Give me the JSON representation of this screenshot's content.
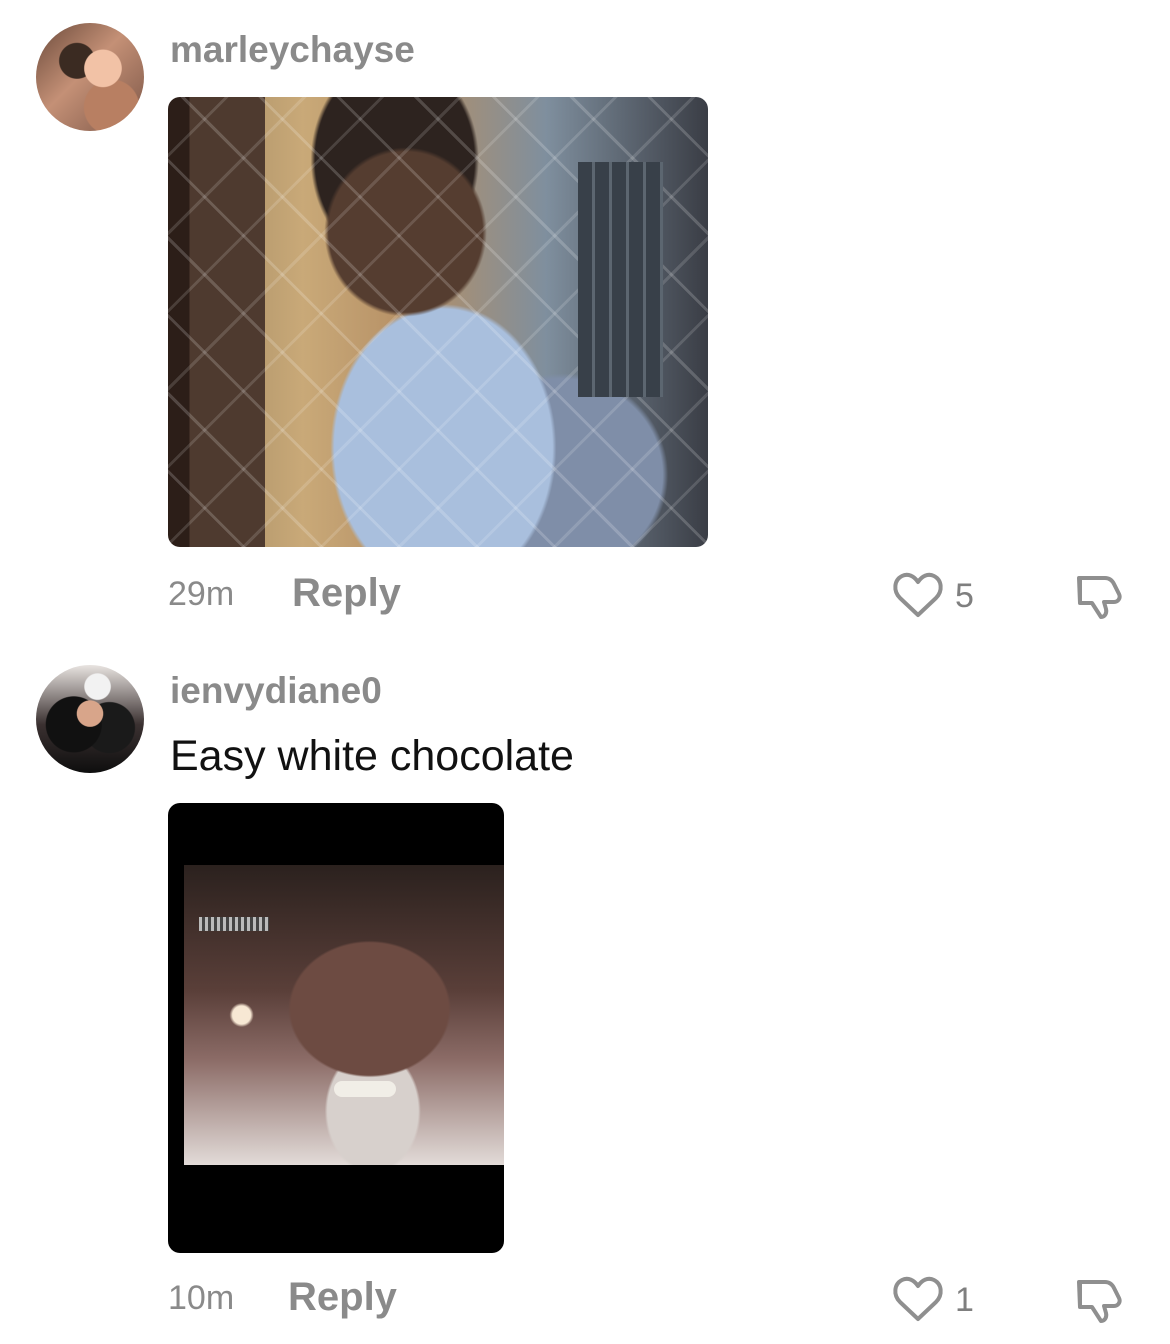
{
  "comments": [
    {
      "username": "marleychayse",
      "timestamp": "29m",
      "reply_label": "Reply",
      "likes": "5",
      "avatar_icon": "profile-avatar",
      "media_icon": "photo-attachment"
    },
    {
      "username": "ienvydiane0",
      "text": "Easy white chocolate",
      "timestamp": "10m",
      "reply_label": "Reply",
      "likes": "1",
      "avatar_icon": "profile-avatar",
      "media_icon": "photo-attachment"
    }
  ],
  "icons": {
    "like": "heart-outline-icon",
    "dislike": "thumbs-down-icon"
  },
  "colors": {
    "background": "#ffffff",
    "secondary_text": "#8a8a8a",
    "primary_text": "#111111",
    "icon": "#8f8f8f"
  }
}
